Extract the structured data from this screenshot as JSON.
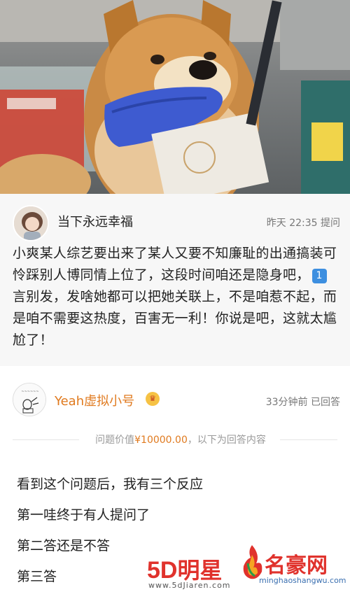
{
  "question": {
    "username": "当下永远幸福",
    "meta": "昨天 22:35 提问",
    "body_part1": "小爽某人综艺要出来了某人又要不知廉耻的出通搞装可怜踩别人博同情上位了，这段时间咱还是隐身吧，",
    "badge": "1",
    "body_part2": "言别发，发啥她都可以把她关联上，不是咱惹不起，而是咱不需要这热度，百害无一利！你说是吧，这就太尴尬了！"
  },
  "answer": {
    "username": "Yeah虚拟小号",
    "meta": "33分钟前 已回答",
    "divider_prefix": "问题价值",
    "price": "¥10000.00",
    "divider_suffix": "，以下为回答内容",
    "paragraphs": [
      "看到这个问题后，我有三个反应",
      "第一哇终于有人提问了",
      "第二答还是不答",
      "第三答"
    ]
  },
  "watermarks": {
    "left_brand_a": "5D",
    "left_brand_b": "明星",
    "left_url": "www.5dJiaren.com",
    "right_brand": "名豪网",
    "right_url": "minghaoshangwu.com"
  },
  "colors": {
    "username_orange": "#e07a1f",
    "badge_blue": "#3d8fe0",
    "watermark_red": "#e0322c"
  },
  "icons": {
    "question_avatar": "avatar-girl-illustration",
    "answer_avatar": "avatar-sketch-illustration",
    "vip": "vip-crown-icon"
  }
}
